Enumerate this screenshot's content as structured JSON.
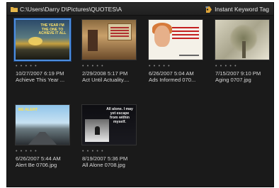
{
  "path_bar": {
    "path": "C:\\Users\\Darry D\\Pictures\\QUOTES\\A",
    "keyword_tag_label": "Instant Keyword Tag"
  },
  "thumbnails": [
    {
      "stars": "• • • • •",
      "date": "10/27/2007 6:19 PM",
      "name": "Achieve This Year ...",
      "selected": true,
      "art_text": "THE YEAR I'M THE ONE TO ACHIEVE IT ALL"
    },
    {
      "stars": "• • • • •",
      "date": "2/29/2008 5:17 PM",
      "name": "Act Until Actuality....",
      "selected": false
    },
    {
      "stars": "• • • • •",
      "date": "6/26/2007 5:04 AM",
      "name": "Ads Informed 070...",
      "selected": false
    },
    {
      "stars": "• • • • •",
      "date": "7/15/2007 9:10 PM",
      "name": "Aging 0707.jpg",
      "selected": false
    },
    {
      "stars": "• • • • •",
      "date": "6/26/2007 5:44 AM",
      "name": "Alert Be 0706.jpg",
      "selected": false,
      "art_text": "BE ALERT"
    },
    {
      "stars": "• • • • •",
      "date": "8/19/2007 5:36 PM",
      "name": "All Alone 0708.jpg",
      "selected": false,
      "art_text": "All alone. I may yet escape from within myself."
    }
  ],
  "colors": {
    "panel_bg": "#1a1a1a",
    "selection_border": "#4d8ee0",
    "text": "#d8d8d8"
  },
  "icons": {
    "folder": "folder-icon",
    "keyword_tag": "keyword-tag-icon"
  }
}
